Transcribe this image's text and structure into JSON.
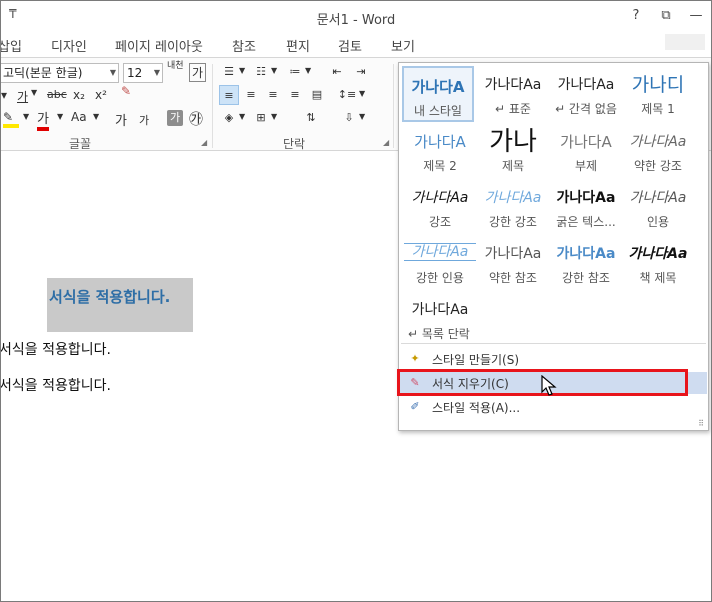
{
  "window": {
    "title": "문서1 - Word",
    "qat_icon": "customize-arrow",
    "controls": [
      "?",
      "⧉",
      "—"
    ]
  },
  "tabs": [
    "삽입",
    "디자인",
    "페이지 레이아웃",
    "참조",
    "편지",
    "검토",
    "보기"
  ],
  "ribbon": {
    "font_name": "고딕(본문 한글)",
    "font_size": "12",
    "font_group_label": "글꼴",
    "paragraph_group_label": "단락",
    "font_buttons": {
      "strike": "abc",
      "subscript": "x₂",
      "superscript": "x²",
      "font_color": "가",
      "case": "Aa",
      "grow": "가",
      "shrink": "가",
      "char_shade": "가",
      "enclose": "㉮",
      "phonetic": "내천",
      "char_border": "가"
    }
  },
  "document": {
    "heading_text": "서식을 적용합니다.",
    "lines": [
      "서식을 적용합니다.",
      "서식을 적용합니다."
    ]
  },
  "gallery": {
    "styles": [
      {
        "preview": "가나다A",
        "label": "내 스타일",
        "active": true
      },
      {
        "preview": "가나다Aa",
        "label": "↵ 표준"
      },
      {
        "preview": "가나다Aa",
        "label": "↵ 간격 없음"
      },
      {
        "preview": "가나디",
        "label": "제목 1"
      },
      {
        "preview": "가나다A",
        "label": "제목 2"
      },
      {
        "preview": "가나",
        "label": "제목"
      },
      {
        "preview": "가나다A",
        "label": "부제"
      },
      {
        "preview": "가나다Aa",
        "label": "약한 강조"
      },
      {
        "preview": "가나다Aa",
        "label": "강조"
      },
      {
        "preview": "가나다Aa",
        "label": "강한 강조"
      },
      {
        "preview": "가나다Aa",
        "label": "굵은 텍스..."
      },
      {
        "preview": "가나다Aa",
        "label": "인용"
      },
      {
        "preview": "가나다Aa",
        "label": "강한 인용"
      },
      {
        "preview": "가나다Aa",
        "label": "약한 참조"
      },
      {
        "preview": "가나다Aa",
        "label": "강한 참조"
      },
      {
        "preview": "가나다Aa",
        "label": "책 제목"
      },
      {
        "preview": "가나다Aa",
        "label": "↵ 목록 단락"
      }
    ],
    "menu": [
      {
        "label": "스타일 만들기(S)",
        "icon": "create-style-icon"
      },
      {
        "label": "서식 지우기(C)",
        "icon": "clear-formatting-icon"
      },
      {
        "label": "스타일 적용(A)...",
        "icon": "apply-styles-icon"
      }
    ]
  }
}
